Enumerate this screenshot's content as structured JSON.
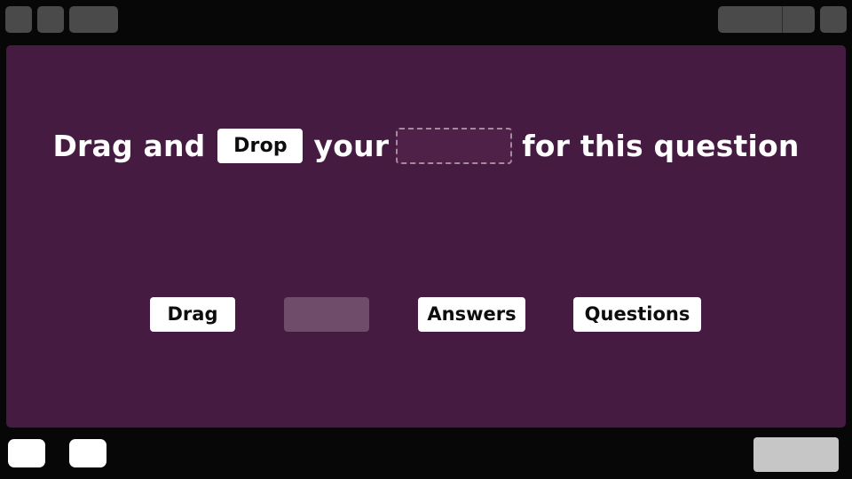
{
  "sentence": {
    "part1": "Drag and",
    "filled_chip": "Drop",
    "part2": "your",
    "part3": "for this question"
  },
  "answers": [
    {
      "label": "Drag",
      "state": "available"
    },
    {
      "label": "",
      "state": "used"
    },
    {
      "label": "Answers",
      "state": "available"
    },
    {
      "label": "Questions",
      "state": "available"
    }
  ],
  "colors": {
    "stage_background": "#461b41",
    "chip_background": "#ffffff",
    "used_slot": "#6f4c6a",
    "drop_slot_border": "#a4899f",
    "submit_button": "#c6c6c6"
  },
  "icons": {
    "top_left": [
      "toolbar-button-icon",
      "toolbar-button-icon",
      "toolbar-button-icon"
    ],
    "top_right": [
      "toolbar-button-icon",
      "toolbar-button-icon",
      "toolbar-button-icon"
    ],
    "bottom_left": [
      "nav-button-icon",
      "nav-button-icon"
    ]
  }
}
